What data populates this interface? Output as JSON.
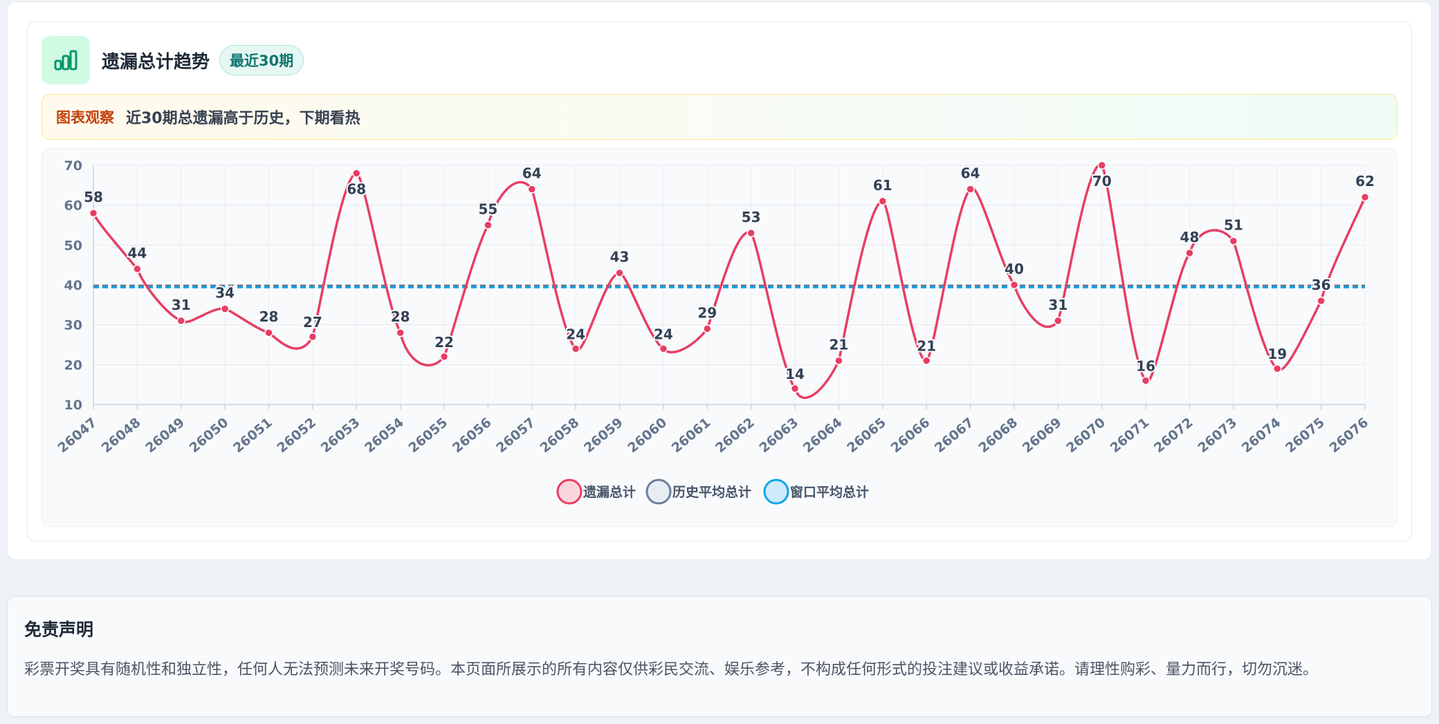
{
  "header": {
    "title": "遗漏总计趋势",
    "badge": "最近30期",
    "icon": "bar-chart-icon"
  },
  "observation": {
    "label": "图表观察",
    "text": "近30期总遗漏高于历史，下期看热"
  },
  "colors": {
    "series_line": "#e83e63",
    "historical_avg": "#64748b",
    "window_avg": "#0ea5e9",
    "accent_green": "#059669"
  },
  "chart_data": {
    "type": "line",
    "title": "",
    "xlabel": "",
    "ylabel": "",
    "ylim": [
      10,
      70
    ],
    "yticks": [
      10,
      20,
      30,
      40,
      50,
      60,
      70
    ],
    "grid": true,
    "legend_position": "bottom",
    "x": [
      "26047",
      "26048",
      "26049",
      "26050",
      "26051",
      "26052",
      "26053",
      "26054",
      "26055",
      "26056",
      "26057",
      "26058",
      "26059",
      "26060",
      "26061",
      "26062",
      "26063",
      "26064",
      "26065",
      "26066",
      "26067",
      "26068",
      "26069",
      "26070",
      "26071",
      "26072",
      "26073",
      "26074",
      "26075",
      "26076"
    ],
    "series": [
      {
        "name": "遗漏总计",
        "values": [
          58,
          44,
          31,
          34,
          28,
          27,
          68,
          28,
          22,
          55,
          64,
          24,
          43,
          24,
          29,
          53,
          14,
          21,
          61,
          21,
          64,
          40,
          31,
          70,
          16,
          48,
          51,
          19,
          36,
          62
        ],
        "smooth": true,
        "data_labels": true
      },
      {
        "name": "历史平均总计",
        "constant": 39.8,
        "style": "dashed"
      },
      {
        "name": "窗口平均总计",
        "constant": 39.4,
        "style": "dashed"
      }
    ]
  },
  "disclaimer": {
    "title": "免责声明",
    "text": "彩票开奖具有随机性和独立性，任何人无法预测未来开奖号码。本页面所展示的所有内容仅供彩民交流、娱乐参考，不构成任何形式的投注建议或收益承诺。请理性购彩、量力而行，切勿沉迷。"
  }
}
